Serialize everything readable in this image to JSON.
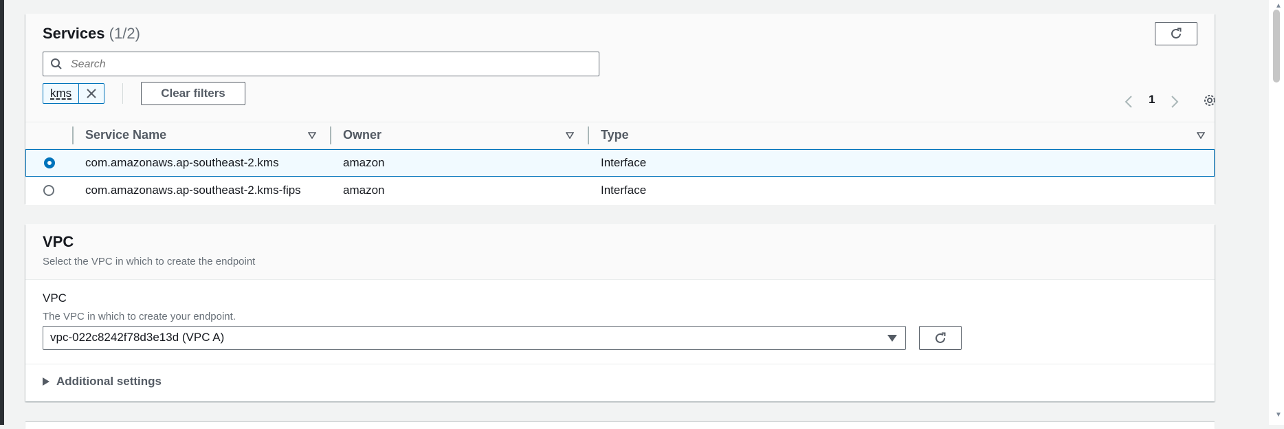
{
  "services": {
    "title": "Services",
    "count": "(1/2)",
    "search_placeholder": "Search",
    "filter_token": "kms",
    "clear_filters_label": "Clear filters",
    "current_page": "1",
    "columns": [
      "Service Name",
      "Owner",
      "Type"
    ],
    "rows": [
      {
        "service_name": "com.amazonaws.ap-southeast-2.kms",
        "owner": "amazon",
        "type": "Interface",
        "selected": true
      },
      {
        "service_name": "com.amazonaws.ap-southeast-2.kms-fips",
        "owner": "amazon",
        "type": "Interface",
        "selected": false
      }
    ]
  },
  "vpc": {
    "title": "VPC",
    "description": "Select the VPC in which to create the endpoint",
    "field_label": "VPC",
    "field_description": "The VPC in which to create your endpoint.",
    "selected_vpc": "vpc-022c8242f78d3e13d (VPC A)",
    "additional_settings_label": "Additional settings"
  },
  "colors": {
    "accent": "#0073bb",
    "selected_row_bg": "#f1faff",
    "text": "#16191f",
    "muted": "#687078"
  },
  "icons": [
    "refresh-icon",
    "search-icon",
    "close-icon",
    "chevron-left-icon",
    "chevron-right-icon",
    "settings-icon",
    "sort-caret-icon",
    "caret-down-icon",
    "caret-right-icon"
  ]
}
